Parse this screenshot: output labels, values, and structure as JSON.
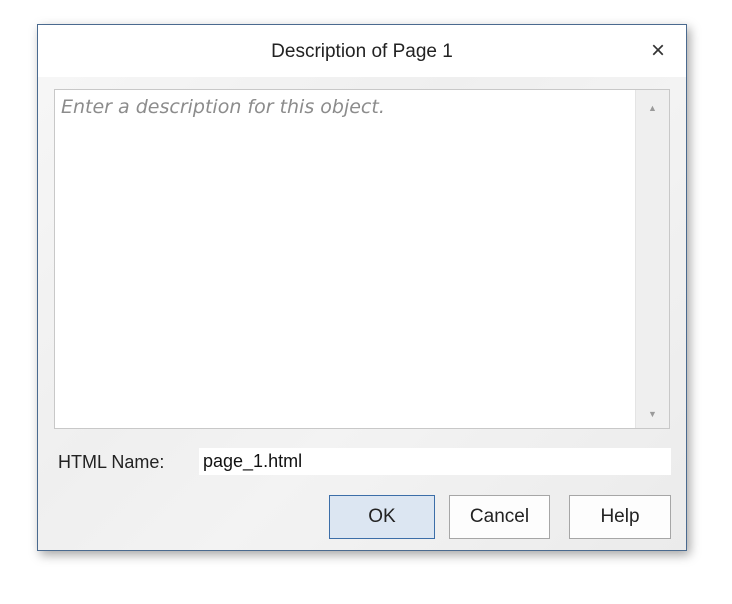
{
  "dialog": {
    "title": "Description of Page 1",
    "close_label": "×"
  },
  "description": {
    "placeholder": "Enter a description for this object.",
    "value": "",
    "scroll_up_icon": "▲",
    "scroll_down_icon": "▼"
  },
  "html_name": {
    "label": "HTML Name:",
    "value": "page_1.html"
  },
  "buttons": {
    "ok": "OK",
    "cancel": "Cancel",
    "help": "Help"
  }
}
